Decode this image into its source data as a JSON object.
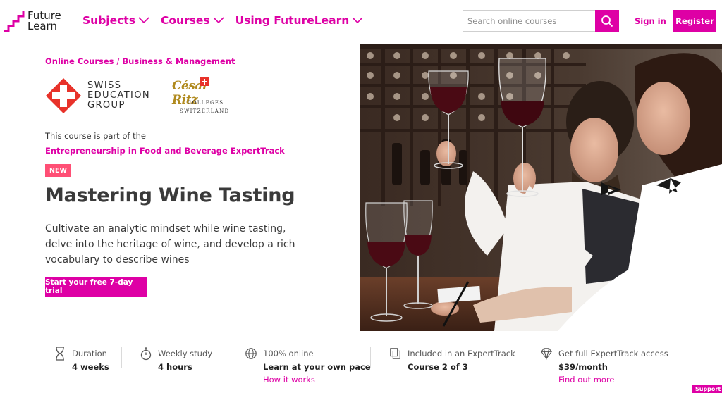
{
  "header": {
    "logo_line1": "Future",
    "logo_line2": "Learn",
    "nav": [
      {
        "label": "Subjects"
      },
      {
        "label": "Courses"
      },
      {
        "label": "Using FutureLearn"
      }
    ],
    "search_placeholder": "Search online courses",
    "signin_label": "Sign in",
    "register_label": "Register"
  },
  "breadcrumb": {
    "items": [
      "Online Courses",
      "Business & Management"
    ],
    "separator": "/"
  },
  "partners": {
    "seg_line1": "SWISS",
    "seg_line2": "EDUCATION",
    "seg_line3": "GROUP",
    "cr_script": "César Ritz",
    "cr_line1": "COLLEGES",
    "cr_line2": "SWITZERLAND"
  },
  "course": {
    "part_of_text": "This course is part of the",
    "expert_track_link": "Entrepreneurship in Food and Beverage ExpertTrack",
    "badge": "NEW",
    "title": "Mastering Wine Tasting",
    "description": "Cultivate an analytic mindset while wine tasting, delve into the heritage of wine, and develop a rich vocabulary to describe wines",
    "cta_label": "Start your free 7-day trial"
  },
  "info": [
    {
      "icon": "hourglass-icon",
      "label": "Duration",
      "value": "4 weeks",
      "link": ""
    },
    {
      "icon": "stopwatch-icon",
      "label": "Weekly study",
      "value": "4 hours",
      "link": ""
    },
    {
      "icon": "globe-icon",
      "label": "100% online",
      "value": "Learn at your own pace",
      "link": "How it works"
    },
    {
      "icon": "pages-icon",
      "label": "Included in an ExpertTrack",
      "value": "Course 2 of 3",
      "link": ""
    },
    {
      "icon": "diamond-icon",
      "label": "Get full ExpertTrack access",
      "value": "$39/month",
      "link": "Find out more"
    }
  ],
  "support_label": "Support",
  "colors": {
    "brand": "#de00a5",
    "badge": "#ff4f75",
    "seg_red": "#e8322a",
    "cesar_gold": "#b08a1e"
  }
}
